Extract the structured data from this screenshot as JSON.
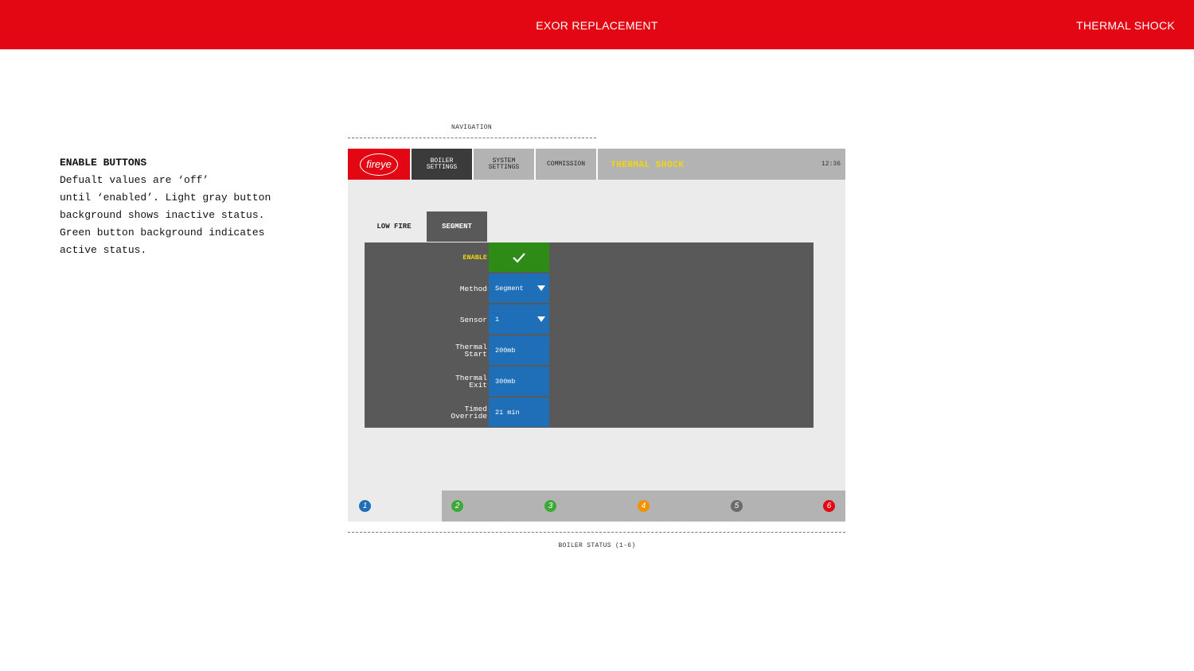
{
  "header": {
    "title": "EXOR REPLACEMENT",
    "section": "THERMAL SHOCK"
  },
  "notes": {
    "heading": "ENABLE BUTTONS",
    "lines": [
      "Defualt values are ‘off’",
      "until ‘enabled’. Light gray button",
      "background shows inactive status.",
      "Green button background indicates",
      "active status."
    ]
  },
  "captions": {
    "navigation": "NAVIGATION",
    "boiler_status": "BOILER STATUS (1-6)"
  },
  "screen": {
    "logo_text": "fireye",
    "nav": [
      {
        "line1": "BOILER",
        "line2": "SETTINGS"
      },
      {
        "line1": "SYSTEM",
        "line2": "SETTINGS"
      },
      {
        "line1": "COMMISSION",
        "line2": ""
      }
    ],
    "title": "THERMAL SHOCK",
    "clock": "12:36",
    "tabs": [
      "LOW FIRE",
      "SEGMENT"
    ],
    "active_tab": "SEGMENT",
    "settings": {
      "enable": {
        "label": "ENABLE",
        "state": "on",
        "icon": "checkmark-icon"
      },
      "method": {
        "label": "Method",
        "value": "Segment"
      },
      "sensor": {
        "label": "Sensor",
        "value": "1"
      },
      "thermal_start": {
        "label1": "Thermal",
        "label2": "Start",
        "value": "200mb"
      },
      "thermal_exit": {
        "label1": "Thermal",
        "label2": "Exit",
        "value": "300mb"
      },
      "timed_override": {
        "label1": "Timed",
        "label2": "Override",
        "value": "21 min"
      }
    },
    "boilers": [
      {
        "num": "1",
        "color": "#1f6fb8"
      },
      {
        "num": "2",
        "color": "#3aa935"
      },
      {
        "num": "3",
        "color": "#3aa935"
      },
      {
        "num": "4",
        "color": "#f39200"
      },
      {
        "num": "5",
        "color": "#6b6b6b"
      },
      {
        "num": "6",
        "color": "#e30613"
      }
    ]
  },
  "colors": {
    "brand_red": "#e30613",
    "active_green": "#2e8b16",
    "field_blue": "#1f6fb8",
    "title_yellow": "#f2d60d"
  }
}
